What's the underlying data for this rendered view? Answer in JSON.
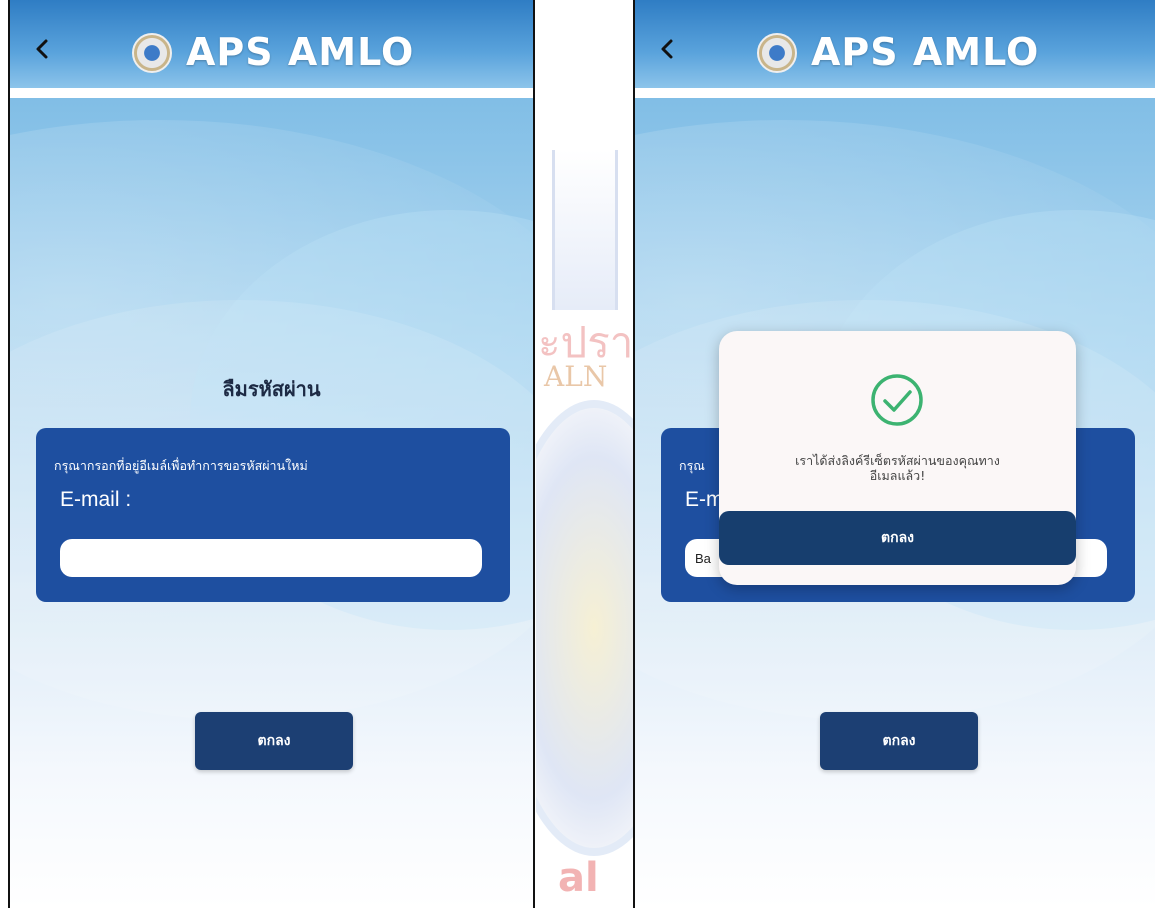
{
  "app": {
    "title": "APS AMLO"
  },
  "left": {
    "heading": "ลืมรหัสผ่าน",
    "instruction": "กรุณากรอกที่อยู่อีเมล์เพื่อทำการขอรหัสผ่านใหม่",
    "email_label": "E-mail :",
    "email_value": "",
    "ok_label": "ตกลง"
  },
  "right": {
    "instruction_partial": "กรุณ",
    "email_label_partial": "E-m",
    "email_value_partial": "Ba",
    "ok_label": "ตกลง",
    "dialog": {
      "message_line1": "เราได้ส่งลิงค์รีเซ็ตรหัสผ่านของคุณทาง",
      "message_line2": "อีเมลแล้ว!",
      "ok_label": "ตกลง"
    }
  },
  "watermark": {
    "text_line1": "ะปรา",
    "text_line2": "ALN",
    "text_bottom": "al"
  },
  "icons": {
    "back": "back-chevron-icon",
    "logo": "amlo-logo-icon",
    "check": "check-circle-icon"
  },
  "colors": {
    "header": "#2f7dc4",
    "card": "#1e4fa0",
    "button": "#1c3f73",
    "check": "#3cb371"
  }
}
